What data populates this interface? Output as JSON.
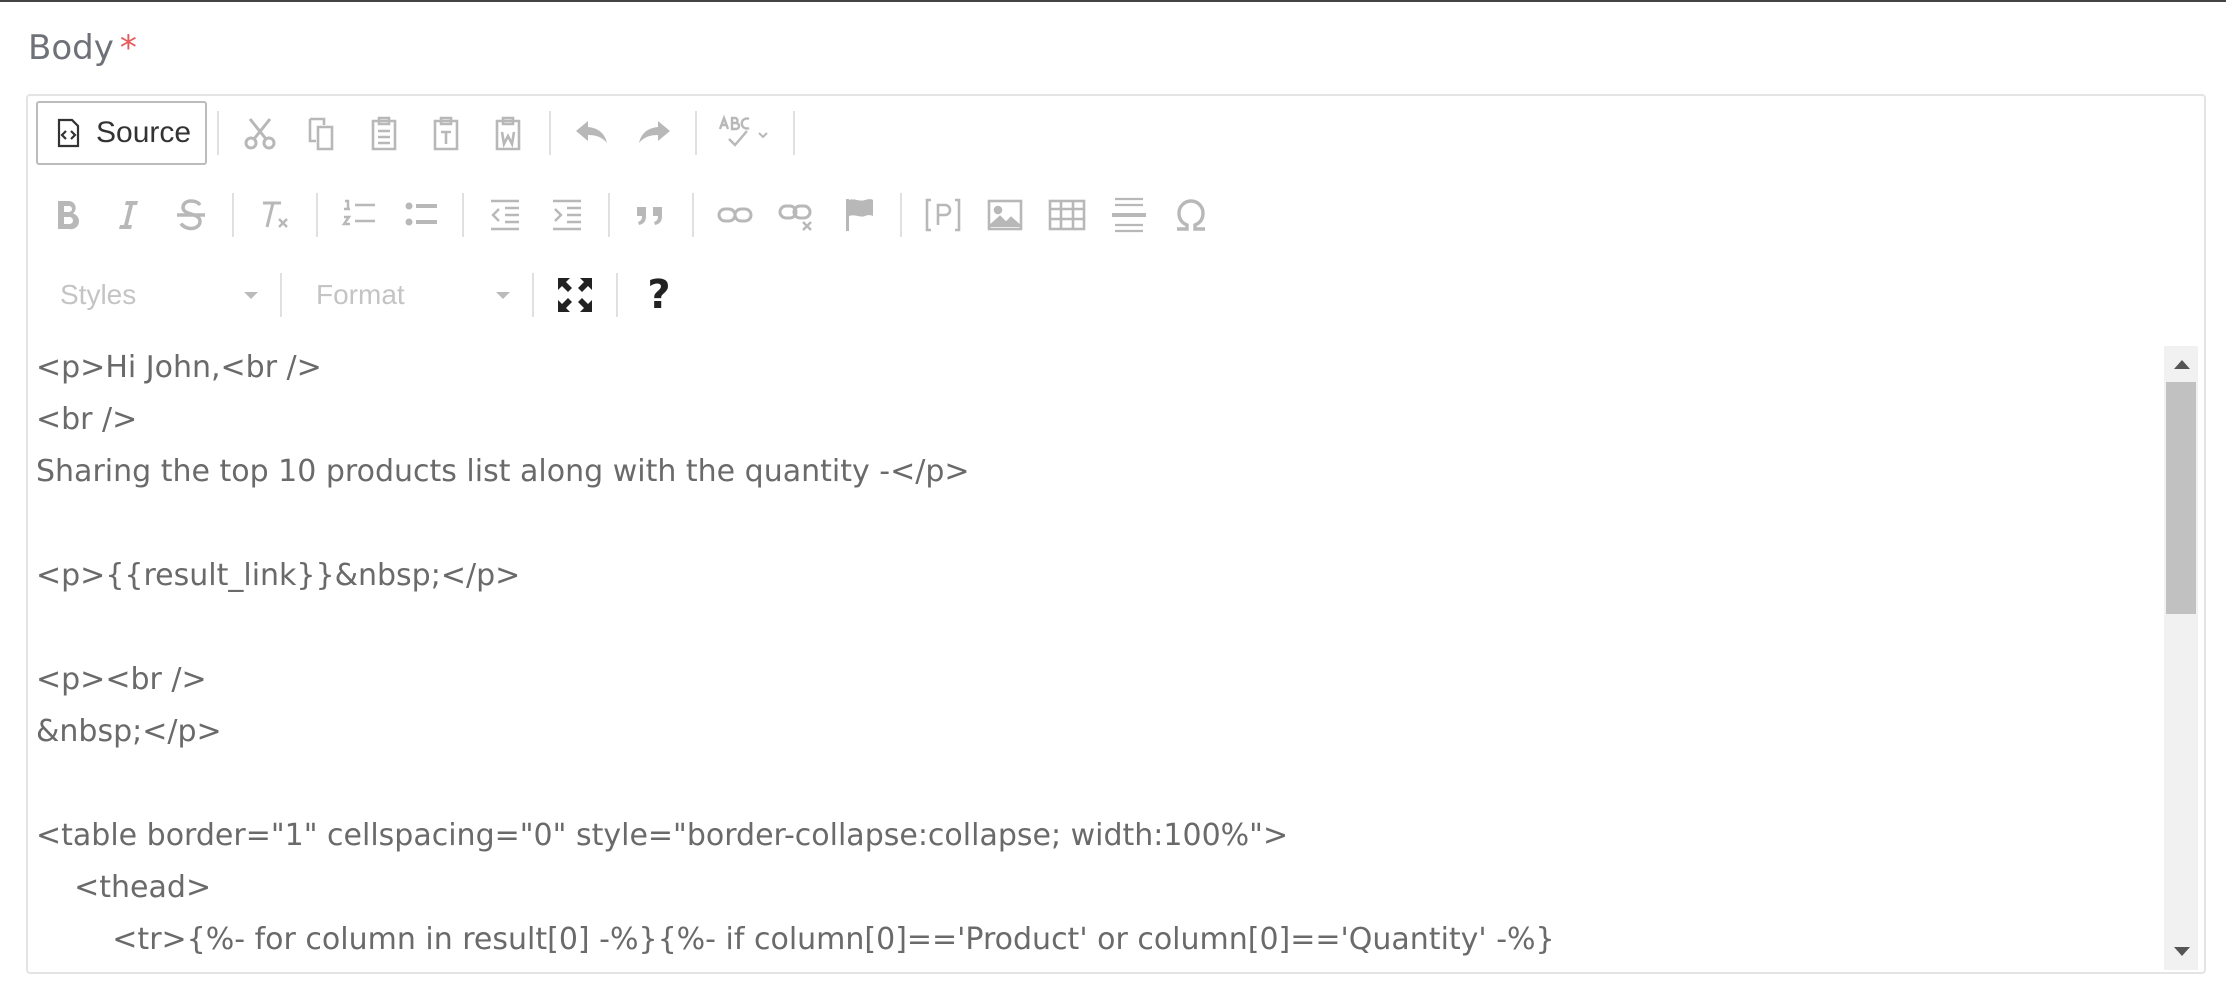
{
  "field": {
    "label": "Body",
    "required_mark": "*"
  },
  "toolbar": {
    "source_label": "Source",
    "styles_label": "Styles",
    "format_label": "Format",
    "help_label": "?"
  },
  "editor": {
    "lines": [
      "<p>Hi John,<br />",
      "<br />",
      "Sharing the top 10 products list along with the quantity -</p>",
      "",
      "<p>{{result_link}}&nbsp;</p>",
      "",
      "<p><br />",
      "&nbsp;</p>",
      "",
      "<table border=\"1\" cellspacing=\"0\" style=\"border-collapse:collapse; width:100%\">",
      "    <thead>",
      "        <tr>{%- for column in result[0] -%}{%- if column[0]=='Product' or column[0]=='Quantity' -%}"
    ]
  }
}
